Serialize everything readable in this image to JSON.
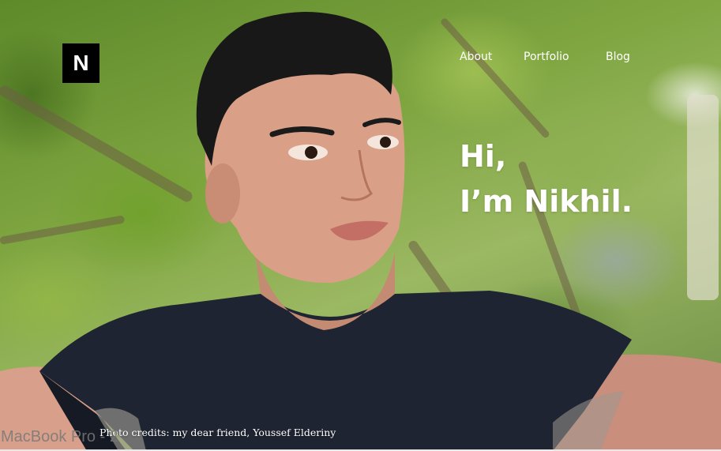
{
  "site": {
    "logo_letter": "N",
    "nav": {
      "about": "About",
      "portfolio": "Portfolio",
      "blog": "Blog"
    },
    "hero": {
      "line1": "Hi,",
      "line2": "I’m Nikhil."
    },
    "photo_credits": "Photo credits: my dear friend, Youssef Elderiny"
  },
  "device": {
    "label": "MacBook Pro - 2"
  },
  "colors": {
    "logo_bg": "#000000",
    "text": "#ffffff",
    "foliage": "#7ea540"
  },
  "icons": {
    "logo": "n-logo-icon"
  }
}
